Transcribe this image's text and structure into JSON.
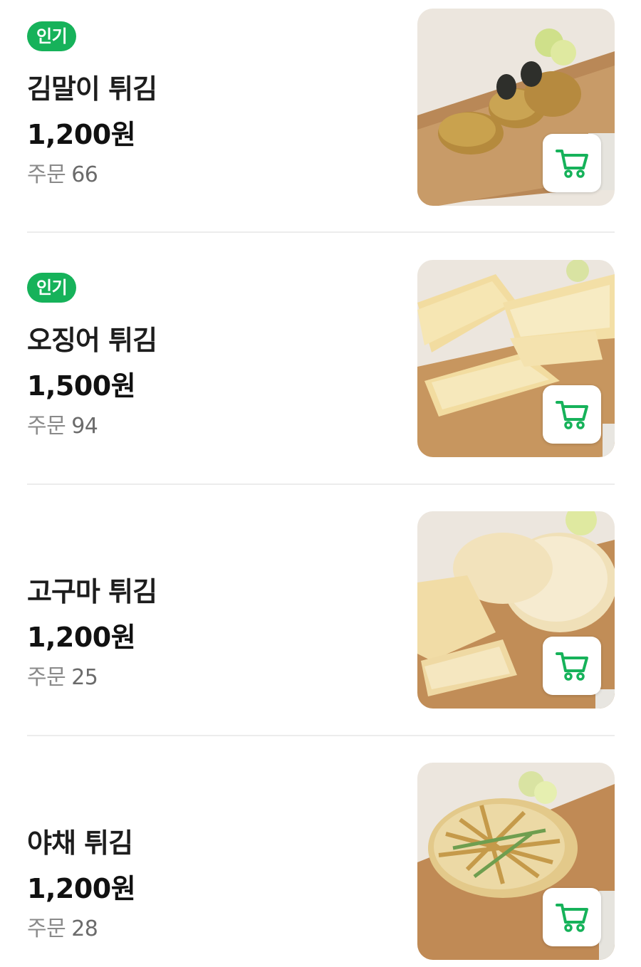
{
  "accent_color": "#16b25a",
  "items": [
    {
      "badge": "인기",
      "name": "김말이 튀김",
      "price": "1,200원",
      "orders_label": "주문",
      "orders_count": "66",
      "image_icon": "food-photo-fried-seaweed-rolls",
      "cart_icon": "cart-icon"
    },
    {
      "badge": "인기",
      "name": "오징어 튀김",
      "price": "1,500원",
      "orders_label": "주문",
      "orders_count": "94",
      "image_icon": "food-photo-fried-squid",
      "cart_icon": "cart-icon"
    },
    {
      "badge": "",
      "name": "고구마 튀김",
      "price": "1,200원",
      "orders_label": "주문",
      "orders_count": "25",
      "image_icon": "food-photo-fried-sweet-potato",
      "cart_icon": "cart-icon"
    },
    {
      "badge": "",
      "name": "야채 튀김",
      "price": "1,200원",
      "orders_label": "주문",
      "orders_count": "28",
      "image_icon": "food-photo-fried-vegetables",
      "cart_icon": "cart-icon"
    }
  ]
}
